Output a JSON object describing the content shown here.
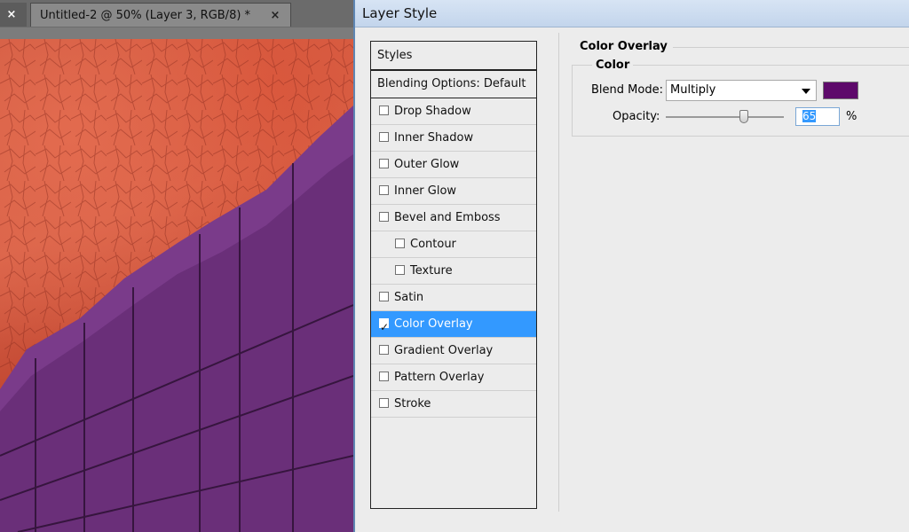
{
  "document": {
    "tabs": [
      {
        "title": "",
        "close": "×"
      },
      {
        "title": "Untitled-2 @ 50% (Layer 3, RGB/8) *",
        "close": "×"
      }
    ]
  },
  "dialog": {
    "title": "Layer Style",
    "styles_header": "Styles",
    "blending_options": "Blending Options: Default",
    "items": [
      {
        "label": "Drop Shadow",
        "checked": false,
        "indent": false
      },
      {
        "label": "Inner Shadow",
        "checked": false,
        "indent": false
      },
      {
        "label": "Outer Glow",
        "checked": false,
        "indent": false
      },
      {
        "label": "Inner Glow",
        "checked": false,
        "indent": false
      },
      {
        "label": "Bevel and Emboss",
        "checked": false,
        "indent": false
      },
      {
        "label": "Contour",
        "checked": false,
        "indent": true
      },
      {
        "label": "Texture",
        "checked": false,
        "indent": true
      },
      {
        "label": "Satin",
        "checked": false,
        "indent": false
      },
      {
        "label": "Color Overlay",
        "checked": true,
        "indent": false,
        "selected": true
      },
      {
        "label": "Gradient Overlay",
        "checked": false,
        "indent": false
      },
      {
        "label": "Pattern Overlay",
        "checked": false,
        "indent": false
      },
      {
        "label": "Stroke",
        "checked": false,
        "indent": false
      }
    ],
    "panel": {
      "title": "Color Overlay",
      "group_title": "Color",
      "blend_mode_label": "Blend Mode:",
      "blend_mode_value": "Multiply",
      "overlay_color": "#5e0a6b",
      "opacity_label": "Opacity:",
      "opacity_value": "65",
      "opacity_unit": "%",
      "opacity_fraction": 0.65
    }
  },
  "colors": {
    "selection": "#3399ff",
    "canvas_red": "#cf5a41",
    "building_purple": "#7a3b8a"
  }
}
